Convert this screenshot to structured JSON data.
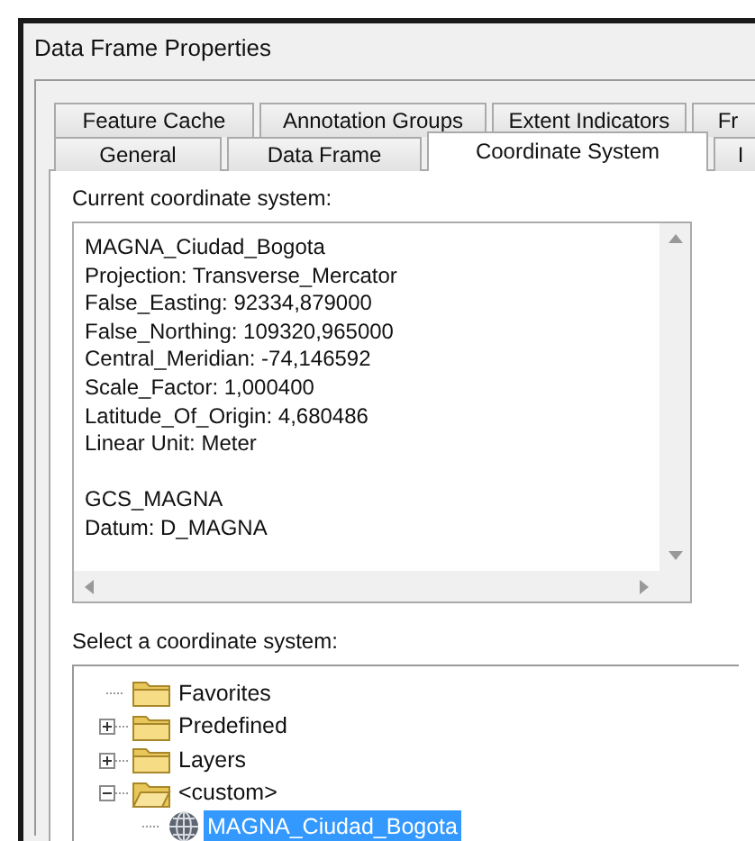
{
  "window": {
    "title": "Data Frame Properties"
  },
  "tab_rows": [
    {
      "tabs": [
        {
          "label": "Feature Cache",
          "selected": false
        },
        {
          "label": "Annotation Groups",
          "selected": false
        },
        {
          "label": "Extent Indicators",
          "selected": false
        },
        {
          "label": "Fr",
          "selected": false
        }
      ]
    },
    {
      "tabs": [
        {
          "label": "General",
          "selected": false
        },
        {
          "label": "Data Frame",
          "selected": false
        },
        {
          "label": "Coordinate System",
          "selected": true
        },
        {
          "label": "I",
          "selected": false
        }
      ]
    }
  ],
  "current": {
    "label": "Current coordinate system:",
    "blocks": [
      [
        "MAGNA_Ciudad_Bogota",
        "Projection: Transverse_Mercator",
        "False_Easting: 92334,879000",
        "False_Northing: 109320,965000",
        "Central_Meridian: -74,146592",
        "Scale_Factor: 1,000400",
        "Latitude_Of_Origin: 4,680486",
        "Linear Unit: Meter"
      ],
      [
        "GCS_MAGNA",
        "Datum: D_MAGNA"
      ]
    ]
  },
  "select": {
    "label": "Select a coordinate system:",
    "tree": [
      {
        "label": "Favorites",
        "kind": "folder",
        "selected": false
      },
      {
        "label": "Predefined",
        "kind": "folder",
        "expanded": false,
        "selected": false
      },
      {
        "label": "Layers",
        "kind": "folder",
        "expanded": false,
        "selected": false
      },
      {
        "label": "<custom>",
        "kind": "folder",
        "expanded": true,
        "selected": false,
        "children": [
          {
            "label": "MAGNA_Ciudad_Bogota",
            "kind": "coordinate-system",
            "selected": true
          }
        ]
      }
    ]
  }
}
